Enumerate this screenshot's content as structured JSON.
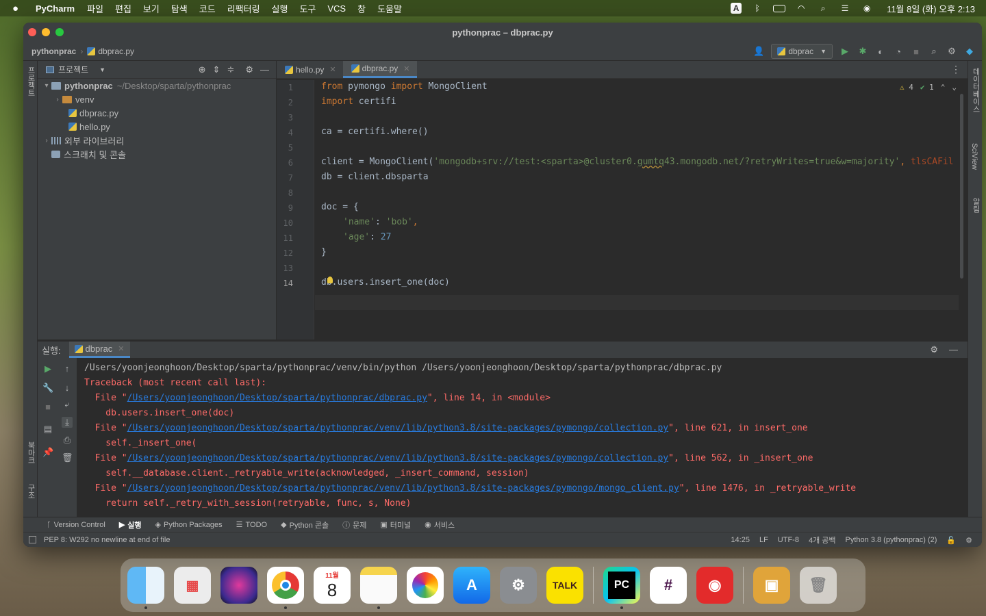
{
  "menubar": {
    "app": "PyCharm",
    "menus": [
      "파일",
      "편집",
      "보기",
      "탐색",
      "코드",
      "리팩터링",
      "실행",
      "도구",
      "VCS",
      "창",
      "도움말"
    ],
    "input_source": "A",
    "clock": "11월 8일 (화) 오후 2:13"
  },
  "window": {
    "title": "pythonprac – dbprac.py"
  },
  "navbar": {
    "project": "pythonprac",
    "file": "dbprac.py",
    "run_config": "dbprac"
  },
  "left_strip": {
    "project_label": "프로젝트",
    "bookmarks_label": "북마크",
    "structure_label": "구조"
  },
  "right_strip": {
    "database_label": "데이터베이스",
    "sciview_label": "SciView",
    "notifications_label": "알림"
  },
  "project": {
    "header": "프로젝트",
    "root_name": "pythonprac",
    "root_path": "~/Desktop/sparta/pythonprac",
    "venv": "venv",
    "file1": "dbprac.py",
    "file2": "hello.py",
    "ext_libs": "외부 라이브러리",
    "scratches": "스크래치 및 콘솔"
  },
  "editor": {
    "tabs": [
      "hello.py",
      "dbprac.py"
    ],
    "active_tab": "dbprac.py",
    "warnings": "4",
    "checks": "1",
    "line_numbers": [
      "1",
      "2",
      "3",
      "4",
      "5",
      "6",
      "7",
      "8",
      "9",
      "10",
      "11",
      "12",
      "13",
      "14"
    ],
    "code": {
      "l1_kw1": "from",
      "l1_mod": " pymongo ",
      "l1_kw2": "import",
      "l1_rest": " MongoClient",
      "l2_kw": "import",
      "l2_rest": " certifi",
      "l4": "ca = certifi.where()",
      "l6_a": "client = MongoClient(",
      "l6_s1": "'mongodb+srv://test:<sparta>@cluster0.",
      "l6_s2": "gumtq",
      "l6_s3": "43.mongodb.net/?retryWrites=true&w=majority'",
      "l6_b": ", ",
      "l6_c": "tlsCAFil",
      "l7": "db = client.dbsparta",
      "l9": "doc = {",
      "l10_s": "'name'",
      "l10_c": ": ",
      "l10_v": "'bob'",
      "l10_e": ",",
      "l11_s": "'age'",
      "l11_c": ": ",
      "l11_v": "27",
      "l12": "}",
      "l14": "db.users.insert_one(doc)"
    }
  },
  "run": {
    "label": "실행:",
    "tab": "dbprac",
    "console": [
      {
        "t": "plain",
        "text": "/Users/yoonjeonghoon/Desktop/sparta/pythonprac/venv/bin/python /Users/yoonjeonghoon/Desktop/sparta/pythonprac/dbprac.py"
      },
      {
        "t": "err",
        "text": "Traceback (most recent call last):"
      },
      {
        "t": "file",
        "pre": "  File \"",
        "link": "/Users/yoonjeonghoon/Desktop/sparta/pythonprac/dbprac.py",
        "post": "\", line 14, in <module>"
      },
      {
        "t": "err",
        "text": "    db.users.insert_one(doc)"
      },
      {
        "t": "file",
        "pre": "  File \"",
        "link": "/Users/yoonjeonghoon/Desktop/sparta/pythonprac/venv/lib/python3.8/site-packages/pymongo/collection.py",
        "post": "\", line 621, in insert_one"
      },
      {
        "t": "err",
        "text": "    self._insert_one("
      },
      {
        "t": "file",
        "pre": "  File \"",
        "link": "/Users/yoonjeonghoon/Desktop/sparta/pythonprac/venv/lib/python3.8/site-packages/pymongo/collection.py",
        "post": "\", line 562, in _insert_one"
      },
      {
        "t": "err",
        "text": "    self.__database.client._retryable_write(acknowledged, _insert_command, session)"
      },
      {
        "t": "file",
        "pre": "  File \"",
        "link": "/Users/yoonjeonghoon/Desktop/sparta/pythonprac/venv/lib/python3.8/site-packages/pymongo/mongo_client.py",
        "post": "\", line 1476, in _retryable_write"
      },
      {
        "t": "err",
        "text": "    return self._retry_with_session(retryable, func, s, None)"
      }
    ]
  },
  "bottom_tabs": [
    "Version Control",
    "실행",
    "Python Packages",
    "TODO",
    "Python 콘솔",
    "문제",
    "터미널",
    "서비스"
  ],
  "status": {
    "message": "PEP 8: W292 no newline at end of file",
    "position": "14:25",
    "line_sep": "LF",
    "encoding": "UTF-8",
    "indent": "4개 공백",
    "interpreter": "Python 3.8 (pythonprac) (2)"
  },
  "dock": {
    "calendar_month": "11월",
    "calendar_day": "8",
    "pycharm": "PC",
    "kakao": "TALK"
  }
}
